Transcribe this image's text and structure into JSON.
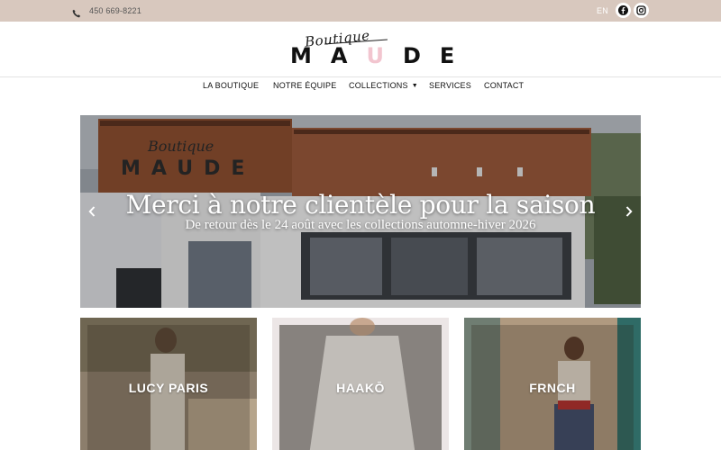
{
  "topbar": {
    "phone": "450 669-8221",
    "language": "EN",
    "social": [
      "facebook-icon",
      "instagram-icon"
    ]
  },
  "logo": {
    "script": "Boutique",
    "letters": [
      "M",
      "A",
      "U",
      "D",
      "E"
    ]
  },
  "nav": {
    "items": [
      {
        "label": "LA BOUTIQUE"
      },
      {
        "label": "NOTRE ÉQUIPE"
      },
      {
        "label": "COLLECTIONS",
        "has_dropdown": true
      },
      {
        "label": "SERVICES"
      },
      {
        "label": "CONTACT"
      }
    ]
  },
  "hero": {
    "title": "Merci à notre clientèle pour la saison",
    "subtitle": "De retour dès le 24 août avec les collections automne-hiver 2026",
    "storefront_sign": "Boutique MAUDE",
    "arrows": [
      "chevron-left-icon",
      "chevron-right-icon"
    ]
  },
  "cards": [
    {
      "label": "LUCY PARIS"
    },
    {
      "label": "HAAKŌ"
    },
    {
      "label": "FRNCH"
    }
  ],
  "colors": {
    "topbar": "#d8c8be",
    "logo_accent": "#f2c5cf",
    "text": "#111111"
  }
}
